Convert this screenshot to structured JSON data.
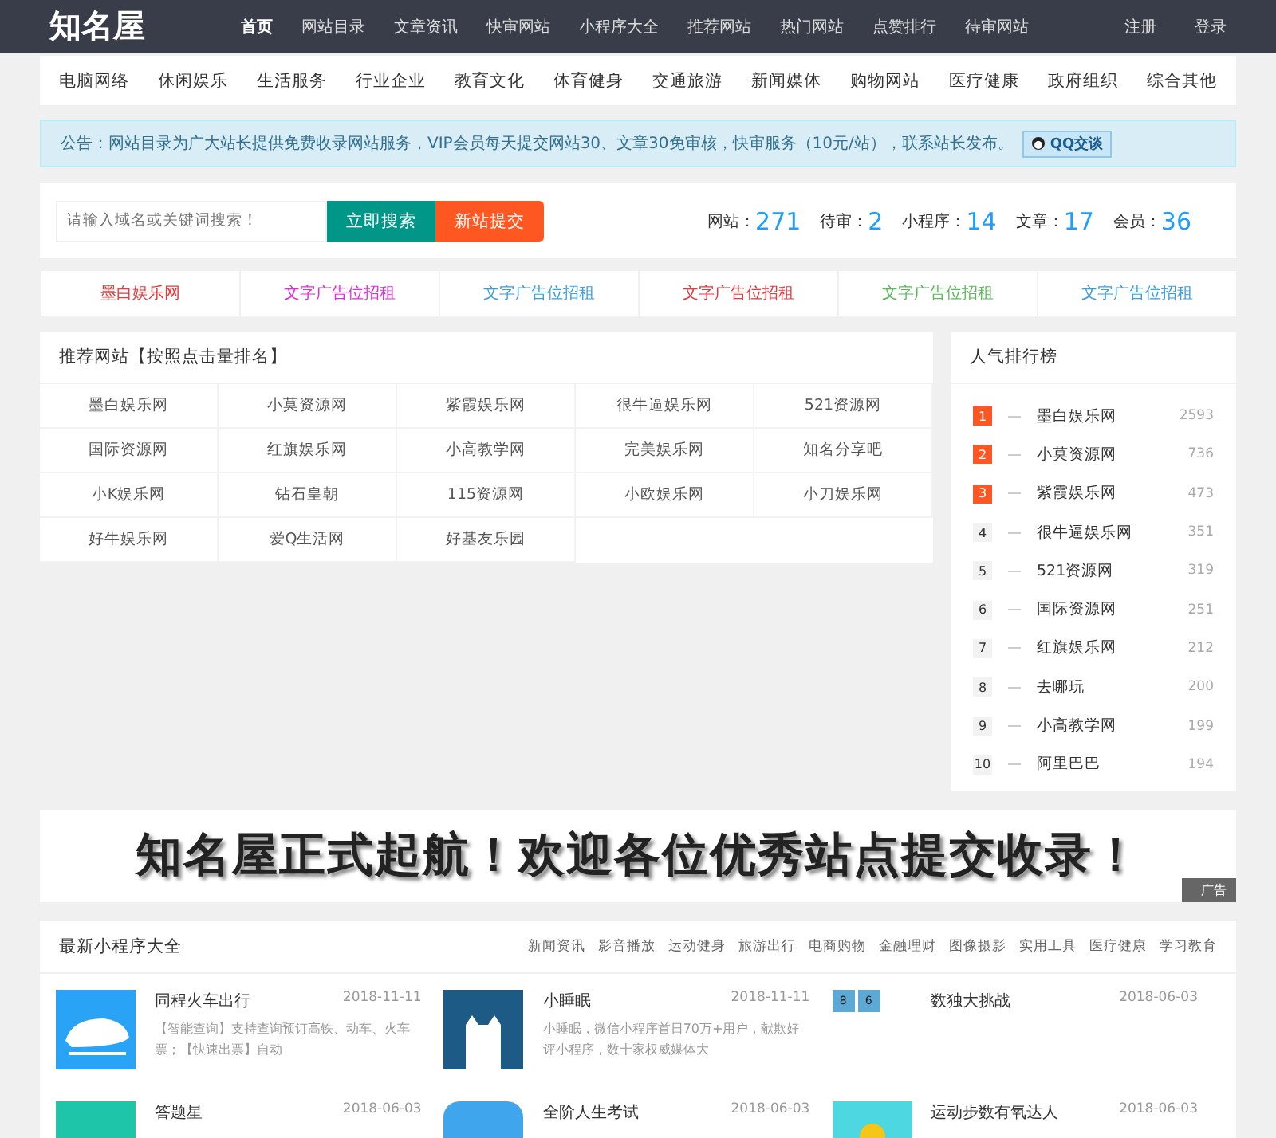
{
  "header": {
    "logo": "知名屋",
    "nav": [
      {
        "label": "首页",
        "selected": true
      },
      {
        "label": "网站目录",
        "selected": false
      },
      {
        "label": "文章资讯",
        "selected": false
      },
      {
        "label": "快审网站",
        "selected": false
      },
      {
        "label": "小程序大全",
        "selected": false
      },
      {
        "label": "推荐网站",
        "selected": false
      },
      {
        "label": "热门网站",
        "selected": false
      },
      {
        "label": "点赞排行",
        "selected": false
      },
      {
        "label": "待审网站",
        "selected": false
      }
    ],
    "user_links": [
      "注册",
      "登录"
    ]
  },
  "categories": [
    "电脑网络",
    "休闲娱乐",
    "生活服务",
    "行业企业",
    "教育文化",
    "体育健身",
    "交通旅游",
    "新闻媒体",
    "购物网站",
    "医疗健康",
    "政府组织",
    "综合其他"
  ],
  "notice": {
    "text": "公告：网站目录为广大站长提供免费收录网站服务，VIP会员每天提交网站30、文章30免审核，快审服务（10元/站），联系站长发布。",
    "qq_button": "QQ交谈"
  },
  "search": {
    "placeholder": "请输入域名或关键词搜索！",
    "search_button": "立即搜索",
    "submit_button": "新站提交"
  },
  "stats": [
    {
      "label": "网站：",
      "value": "271"
    },
    {
      "label": "待审：",
      "value": "2"
    },
    {
      "label": "小程序：",
      "value": "14"
    },
    {
      "label": "文章：",
      "value": "17"
    },
    {
      "label": "会员：",
      "value": "36"
    }
  ],
  "ads": [
    {
      "text": "墨白娱乐网",
      "color": "#e8383d"
    },
    {
      "text": "文字广告位招租",
      "color": "#e52be0"
    },
    {
      "text": "文字广告位招租",
      "color": "#3a9ee4"
    },
    {
      "text": "文字广告位招租",
      "color": "#e8383d"
    },
    {
      "text": "文字广告位招租",
      "color": "#5cb85c"
    },
    {
      "text": "文字广告位招租",
      "color": "#3a9ee4"
    }
  ],
  "recommended": {
    "title": "推荐网站【按照点击量排名】",
    "sites": [
      "墨白娱乐网",
      "小莫资源网",
      "紫霞娱乐网",
      "很牛逼娱乐网",
      "521资源网",
      "国际资源网",
      "红旗娱乐网",
      "小高教学网",
      "完美娱乐网",
      "知名分享吧",
      "小K娱乐网",
      "钻石皇朝",
      "115资源网",
      "小欧娱乐网",
      "小刀娱乐网",
      "好牛娱乐网",
      "爱Q生活网",
      "好基友乐园"
    ]
  },
  "ranking": {
    "title": "人气排行榜",
    "items": [
      {
        "rank": "1",
        "name": "墨白娱乐网",
        "count": "2593",
        "top": true
      },
      {
        "rank": "2",
        "name": "小莫资源网",
        "count": "736",
        "top": true
      },
      {
        "rank": "3",
        "name": "紫霞娱乐网",
        "count": "473",
        "top": true
      },
      {
        "rank": "4",
        "name": "很牛逼娱乐网",
        "count": "351",
        "top": false
      },
      {
        "rank": "5",
        "name": "521资源网",
        "count": "319",
        "top": false
      },
      {
        "rank": "6",
        "name": "国际资源网",
        "count": "251",
        "top": false
      },
      {
        "rank": "7",
        "name": "红旗娱乐网",
        "count": "212",
        "top": false
      },
      {
        "rank": "8",
        "name": "去哪玩",
        "count": "200",
        "top": false
      },
      {
        "rank": "9",
        "name": "小高教学网",
        "count": "199",
        "top": false
      },
      {
        "rank": "10",
        "name": "阿里巴巴",
        "count": "194",
        "top": false
      }
    ]
  },
  "banner": {
    "text": "知名屋正式起航！欢迎各位优秀站点提交收录！",
    "tag": "广告"
  },
  "apps": {
    "title": "最新小程序大全",
    "tabs": [
      "新闻资讯",
      "影音播放",
      "运动健身",
      "旅游出行",
      "电商购物",
      "金融理财",
      "图像摄影",
      "实用工具",
      "医疗健康",
      "学习教育"
    ],
    "items": [
      {
        "kind": "train",
        "name": "同程火车出行",
        "date": "2018-11-11",
        "desc": "【智能查询】支持查询预订高铁、动车、火车票；【快速出票】自动"
      },
      {
        "kind": "cat",
        "name": "小睡眠",
        "date": "2018-11-11",
        "desc": "小睡眠，微信小程序首日70万+用户，献欺好评小程序，数十家权威媒体大"
      },
      {
        "kind": "tiles",
        "name": "数独大挑战",
        "date": "2018-06-03",
        "tiles": [
          "8",
          "6"
        ]
      },
      {
        "kind": "plain",
        "name": "答题星",
        "date": "2018-06-03"
      },
      {
        "kind": "round",
        "name": "全阶人生考试",
        "date": "2018-06-03"
      },
      {
        "kind": "sun",
        "name": "运动步数有氧达人",
        "date": "2018-06-03"
      }
    ]
  }
}
